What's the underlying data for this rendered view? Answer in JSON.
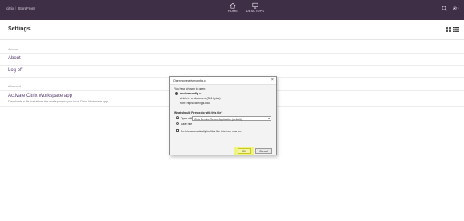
{
  "topbar": {
    "brand": "citrix",
    "product": "StoreFront",
    "nav": [
      {
        "label": "HOME",
        "icon": "home-icon"
      },
      {
        "label": "DESKTOPS",
        "icon": "desktop-icon"
      }
    ],
    "icons": [
      "search-icon",
      "gear-icon"
    ],
    "background": "#3e2e46"
  },
  "header": {
    "title": "Settings",
    "view_icons": [
      "grid-view-icon",
      "list-view-icon"
    ]
  },
  "account": {
    "section_label": "Account",
    "about": "About",
    "logoff": "Log off"
  },
  "advanced": {
    "section_label": "Advanced",
    "activate_title": "Activate Citrix Workspace app",
    "activate_desc": "Downloads a file that allows the workspace to your local Citrix Workspace app."
  },
  "dialog": {
    "title": "Opening receiverconfig.cr",
    "close": "×",
    "intro": "You have chosen to open:",
    "filename": "receiverconfig.cr",
    "which_is": "which is: cr document (331 bytes)",
    "from": "from: https://citrix.gs.edu",
    "question": "What should Firefox do with this file?",
    "open_with_label": "Open with",
    "open_with_value": "Citrix Service Record Application (default)",
    "save_file_label": "Save File",
    "auto_label": "Do this automatically for files like this from now on.",
    "ok_label": "OK",
    "cancel_label": "Cancel"
  }
}
